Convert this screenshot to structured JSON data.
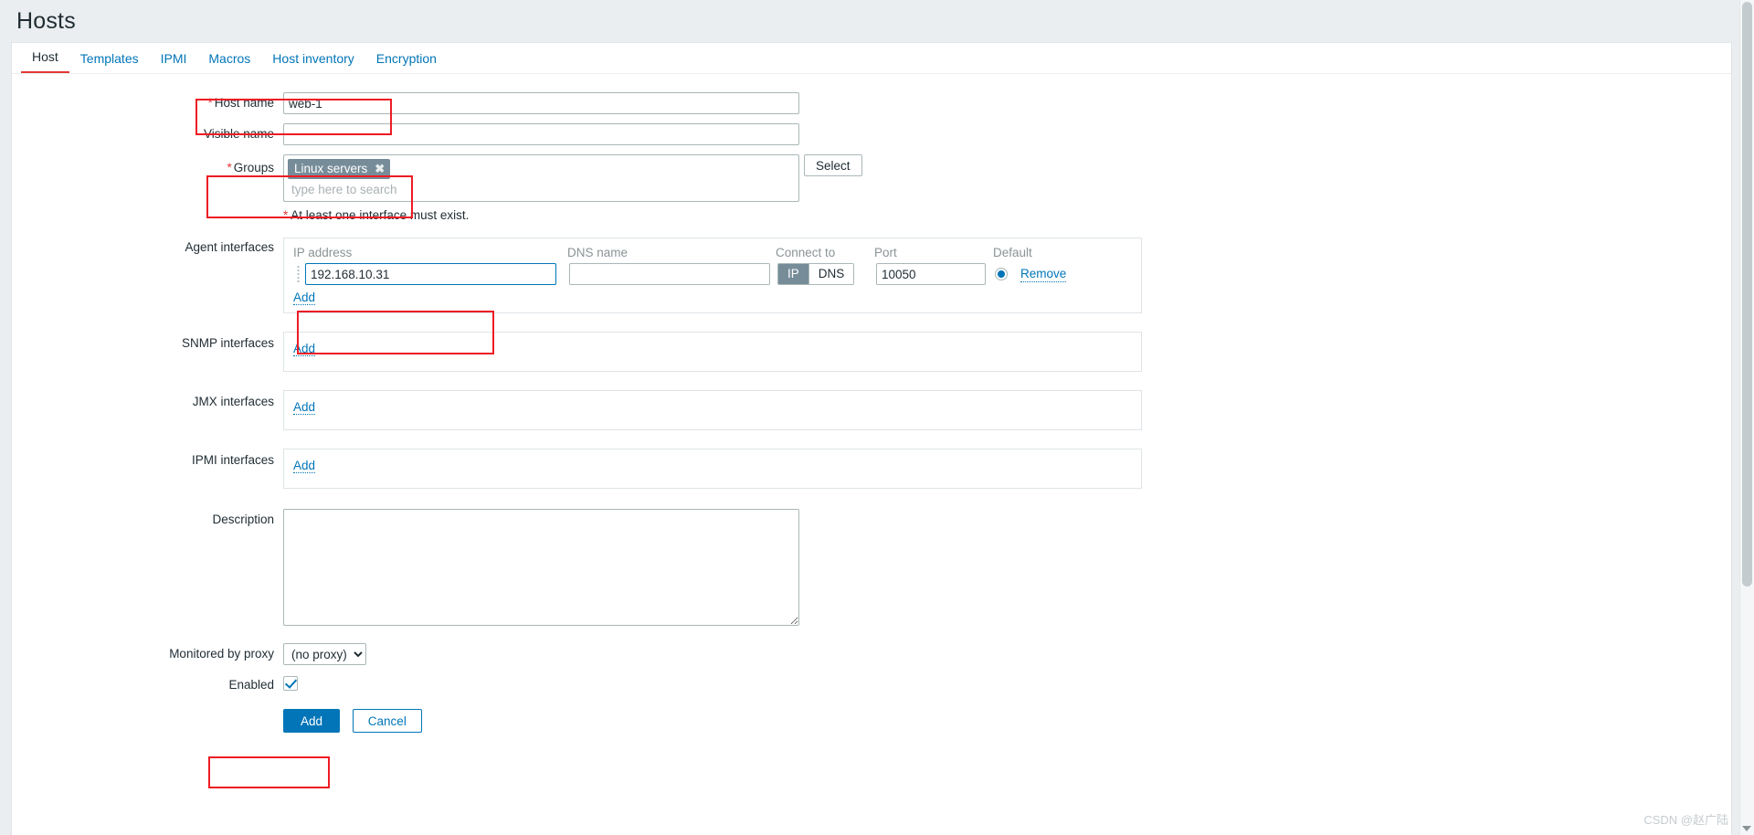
{
  "header": {
    "title": "Hosts"
  },
  "tabs": [
    {
      "label": "Host",
      "active": true
    },
    {
      "label": "Templates",
      "active": false
    },
    {
      "label": "IPMI",
      "active": false
    },
    {
      "label": "Macros",
      "active": false
    },
    {
      "label": "Host inventory",
      "active": false
    },
    {
      "label": "Encryption",
      "active": false
    }
  ],
  "form": {
    "host_name": {
      "label": "Host name",
      "required_marker": "*",
      "value": "web-1",
      "placeholder": ""
    },
    "visible_name": {
      "label": "Visible name",
      "value": "",
      "placeholder": ""
    },
    "groups": {
      "label": "Groups",
      "required_marker": "*",
      "chips": [
        {
          "label": "Linux servers",
          "remove_icon": "✖"
        }
      ],
      "search_placeholder": "type here to search",
      "select_button": "Select"
    },
    "interface_hint": {
      "marker": "*",
      "text": "At least one interface must exist."
    },
    "agent_interfaces": {
      "label": "Agent interfaces",
      "columns": {
        "ip": "IP address",
        "dns": "DNS name",
        "connect_to": "Connect to",
        "port": "Port",
        "default": "Default"
      },
      "rows": [
        {
          "ip_value": "192.168.10.31",
          "ip_placeholder": "",
          "dns_value": "",
          "dns_placeholder": "",
          "connect_to_options": [
            "IP",
            "DNS"
          ],
          "connect_to_selected": "IP",
          "port_value": "10050",
          "default_selected": true,
          "remove_label": "Remove"
        }
      ],
      "add_label": "Add"
    },
    "snmp_interfaces": {
      "label": "SNMP interfaces",
      "add_label": "Add"
    },
    "jmx_interfaces": {
      "label": "JMX interfaces",
      "add_label": "Add"
    },
    "ipmi_interfaces": {
      "label": "IPMI interfaces",
      "add_label": "Add"
    },
    "description": {
      "label": "Description",
      "value": "",
      "placeholder": ""
    },
    "monitored_by_proxy": {
      "label": "Monitored by proxy",
      "selected": "(no proxy)",
      "options": [
        "(no proxy)"
      ]
    },
    "enabled": {
      "label": "Enabled",
      "checked": true
    },
    "actions": {
      "submit": "Add",
      "cancel": "Cancel"
    }
  },
  "watermark": "CSDN @赵广陆",
  "colors": {
    "accent": "#0275b8",
    "required": "#e33734",
    "annotation": "#ee1c24",
    "chip_bg": "#768d99",
    "header_bg": "#ebeef0"
  }
}
